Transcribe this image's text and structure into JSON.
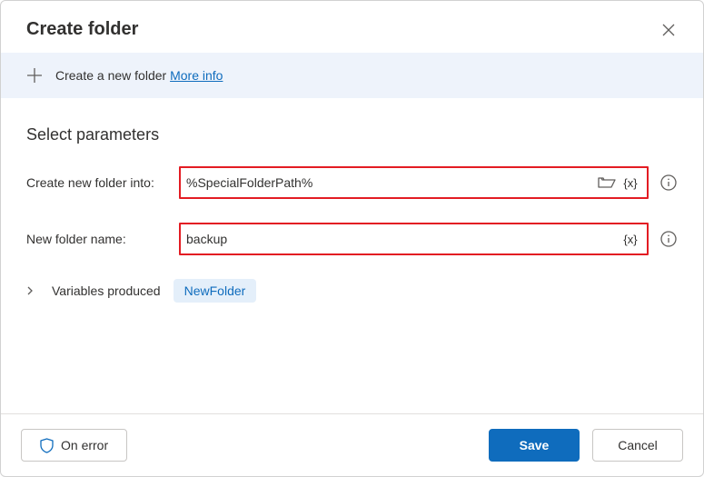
{
  "dialog": {
    "title": "Create folder"
  },
  "info_strip": {
    "text": "Create a new folder",
    "more_info": "More info"
  },
  "section": {
    "title": "Select parameters"
  },
  "params": {
    "path": {
      "label": "Create new folder into:",
      "value": "%SpecialFolderPath%"
    },
    "name": {
      "label": "New folder name:",
      "value": "backup"
    }
  },
  "variables": {
    "label": "Variables produced",
    "chip": "NewFolder"
  },
  "footer": {
    "on_error": "On error",
    "save": "Save",
    "cancel": "Cancel"
  }
}
